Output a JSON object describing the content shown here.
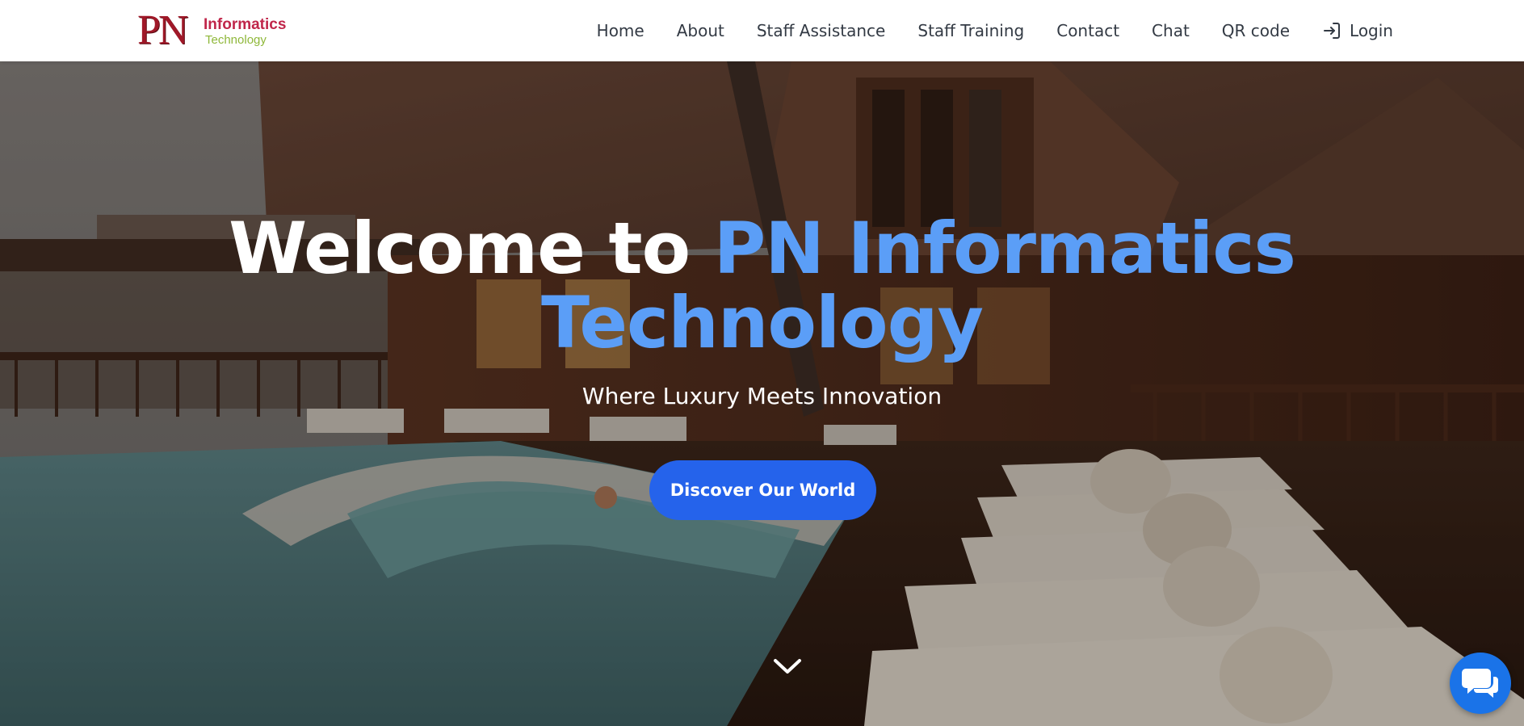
{
  "brand": {
    "logo_mark": "PN",
    "logo_word1": "Informatics",
    "logo_word2": "Technology",
    "colors": {
      "mark": "#a01828",
      "word1": "#c0264a",
      "word2": "#8fb83a"
    }
  },
  "nav": {
    "items": [
      {
        "label": "Home"
      },
      {
        "label": "About"
      },
      {
        "label": "Staff Assistance"
      },
      {
        "label": "Staff Training"
      },
      {
        "label": "Contact"
      },
      {
        "label": "Chat"
      },
      {
        "label": "QR code"
      }
    ],
    "login": {
      "label": "Login",
      "icon": "login-icon"
    }
  },
  "hero": {
    "title_prefix": "Welcome to ",
    "title_accent": "PN Informatics Technology",
    "subtitle": "Where Luxury Meets Innovation",
    "cta_label": "Discover Our World",
    "scroll_icon": "chevron-down-icon",
    "chat_icon": "chat-bubbles-icon",
    "colors": {
      "accent": "#5b9ef7",
      "button": "#2563eb",
      "chat": "#1a73e8"
    }
  }
}
